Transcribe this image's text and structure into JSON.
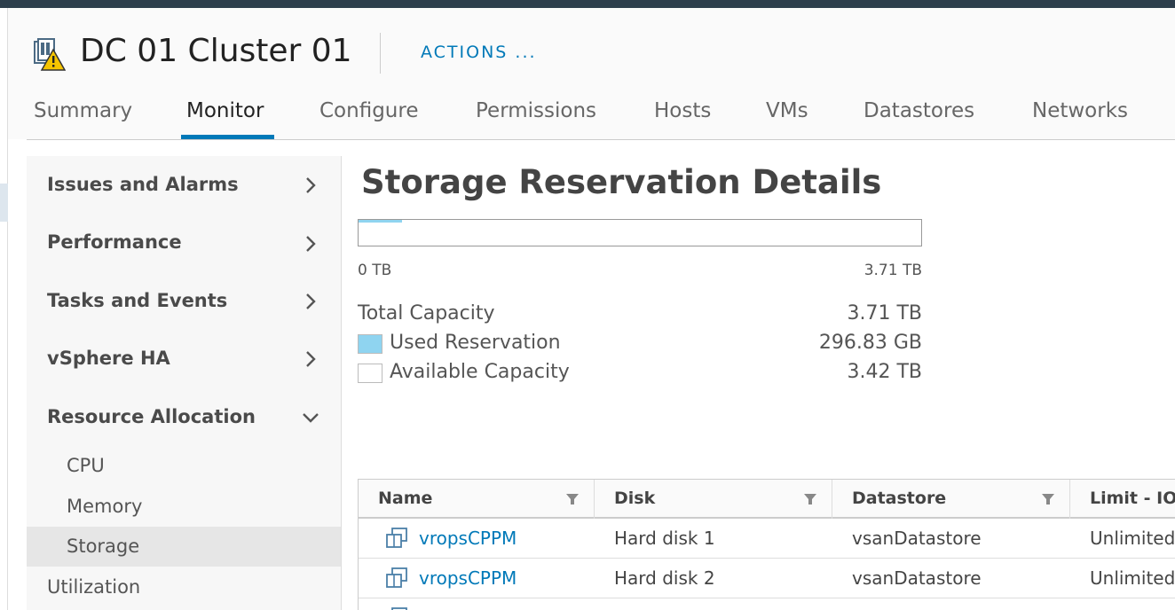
{
  "header": {
    "object_title": "DC 01 Cluster 01",
    "object_icon": "cluster-warning-icon",
    "actions_label": "ACTIONS ..."
  },
  "tabs": [
    {
      "label": "Summary",
      "active": false
    },
    {
      "label": "Monitor",
      "active": true
    },
    {
      "label": "Configure",
      "active": false
    },
    {
      "label": "Permissions",
      "active": false
    },
    {
      "label": "Hosts",
      "active": false
    },
    {
      "label": "VMs",
      "active": false
    },
    {
      "label": "Datastores",
      "active": false
    },
    {
      "label": "Networks",
      "active": false
    }
  ],
  "sidebar": {
    "groups": [
      {
        "label": "Issues and Alarms",
        "expanded": false
      },
      {
        "label": "Performance",
        "expanded": false
      },
      {
        "label": "Tasks and Events",
        "expanded": false
      },
      {
        "label": "vSphere HA",
        "expanded": false
      },
      {
        "label": "Resource Allocation",
        "expanded": true
      }
    ],
    "resource_allocation_items": [
      {
        "label": "CPU",
        "selected": false
      },
      {
        "label": "Memory",
        "selected": false
      },
      {
        "label": "Storage",
        "selected": true
      }
    ],
    "utilization_label": "Utilization"
  },
  "storage": {
    "title": "Storage Reservation Details",
    "bar_used_fraction": 0.078,
    "bar_min_label": "0 TB",
    "bar_max_label": "3.71 TB",
    "total_capacity_label": "Total Capacity",
    "total_capacity_value": "3.71 TB",
    "used_reservation_label": "Used Reservation",
    "used_reservation_value": "296.83 GB",
    "available_capacity_label": "Available Capacity",
    "available_capacity_value": "3.42 TB",
    "used_color": "#8fd4f0",
    "available_color": "#ffffff"
  },
  "grid": {
    "columns": [
      "Name",
      "Disk",
      "Datastore",
      "Limit - IOP"
    ],
    "rows": [
      {
        "name": "vropsCPPM",
        "disk": "Hard disk 1",
        "datastore": "vsanDatastore",
        "limit": "Unlimited"
      },
      {
        "name": "vropsCPPM",
        "disk": "Hard disk 2",
        "datastore": "vsanDatastore",
        "limit": "Unlimited"
      }
    ]
  },
  "colors": {
    "accent": "#0079b8",
    "topbar": "#2d3e4c"
  }
}
